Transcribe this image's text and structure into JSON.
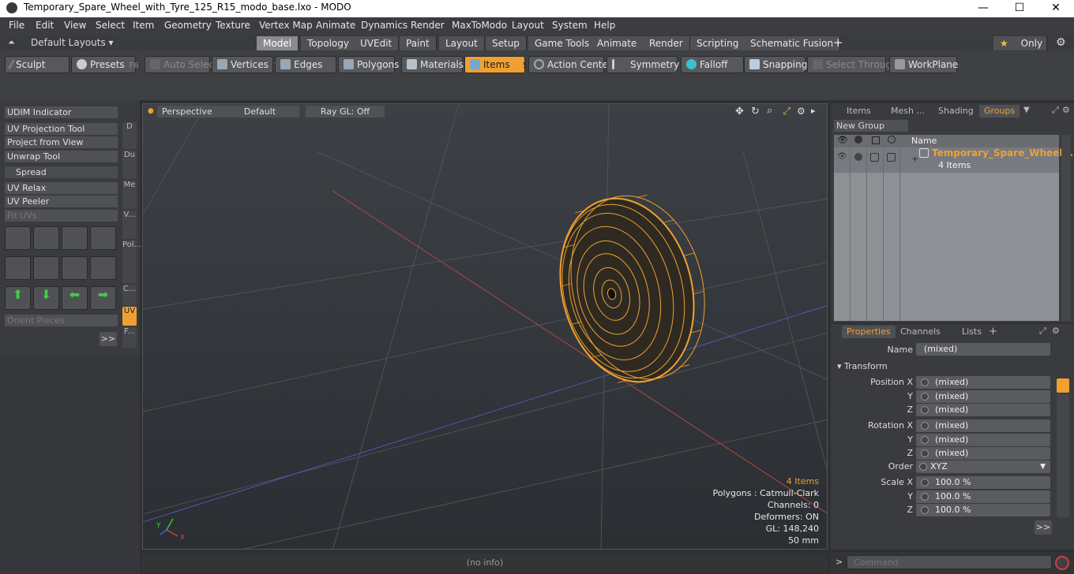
{
  "window": {
    "title": "Temporary_Spare_Wheel_with_Tyre_125_R15_modo_base.lxo - MODO",
    "minimize": "—",
    "maximize": "☐",
    "close": "✕"
  },
  "menubar": {
    "items": [
      "File",
      "Edit",
      "View",
      "Select",
      "Item",
      "Geometry",
      "Texture",
      "Vertex Map",
      "Animate",
      "Dynamics",
      "Render",
      "MaxToModo",
      "Layout",
      "System",
      "Help"
    ]
  },
  "layouts": {
    "label": "Default Layouts ▾",
    "tabs": [
      "Model",
      "Topology",
      "UVEdit",
      "Paint",
      "Layout",
      "Setup",
      "Game Tools",
      "Animate",
      "Render",
      "Scripting",
      "Schematic Fusion"
    ],
    "active": "Model",
    "add": "+",
    "only": "Only",
    "star": "★",
    "gear": "⚙"
  },
  "toolbar": {
    "sculpt": "Sculpt",
    "presets": "Presets",
    "presets_key": "F6",
    "auto_select": "Auto Select",
    "vertices": "Vertices",
    "vertices_num": "1",
    "edges": "Edges",
    "edges_num": "2",
    "polygons": "Polygons",
    "materials": "Materials",
    "items": "Items",
    "items_num": "5",
    "action_center": "Action Center",
    "symmetry": "Symmetry",
    "falloff": "Falloff",
    "snapping": "Snapping",
    "select_through": "Select Through",
    "workplane": "WorkPlane"
  },
  "left_panel": {
    "buttons": [
      "UDIM Indicator",
      "UV Projection Tool",
      "Project from View",
      "Unwrap Tool",
      "Spread",
      "UV Relax",
      "UV Peeler",
      "Fit UVs"
    ],
    "orient": "Orient Pieces",
    "more": ">>",
    "vtabs": [
      "D",
      "Du",
      "Me",
      "V...",
      "Pol...",
      "C...",
      "UV",
      "F..."
    ]
  },
  "viewport": {
    "view": "Perspective",
    "shading": "Default",
    "raygl": "Ray GL: Off",
    "info": {
      "items": "4 Items",
      "polygons": "Polygons : Catmull-Clark",
      "channels": "Channels: 0",
      "deformers": "Deformers: ON",
      "gl": "GL: 148,240",
      "scale": "50 mm"
    },
    "axis_labels": {
      "x": "X",
      "y": "Y"
    }
  },
  "groups_panel": {
    "tabs": [
      "Items",
      "Mesh ...",
      "Shading",
      "Groups"
    ],
    "active": "Groups",
    "new_group": "New Group",
    "col_name": "Name",
    "group_name": "Temporary_Spare_Wheel...",
    "group_count": "4 Items"
  },
  "properties_panel": {
    "tabs": [
      "Properties",
      "Channels",
      "Lists"
    ],
    "active": "Properties",
    "add": "+",
    "name_label": "Name",
    "name_value": "(mixed)",
    "transform": "Transform",
    "position_label": "Position X",
    "rotation_label": "Rotation X",
    "scale_label": "Scale X",
    "y": "Y",
    "z": "Z",
    "position": [
      "(mixed)",
      "(mixed)",
      "(mixed)"
    ],
    "rotation": [
      "(mixed)",
      "(mixed)",
      "(mixed)"
    ],
    "order_label": "Order",
    "order": "XYZ",
    "scale": [
      "100.0 %",
      "100.0 %",
      "100.0 %"
    ],
    "more": ">>"
  },
  "status": {
    "info": "(no info)"
  },
  "command": {
    "placeholder": "Command",
    "prompt": ">"
  },
  "colors": {
    "accent": "#f0a030",
    "wire": "#f0a030",
    "bg": "#2f3033"
  }
}
